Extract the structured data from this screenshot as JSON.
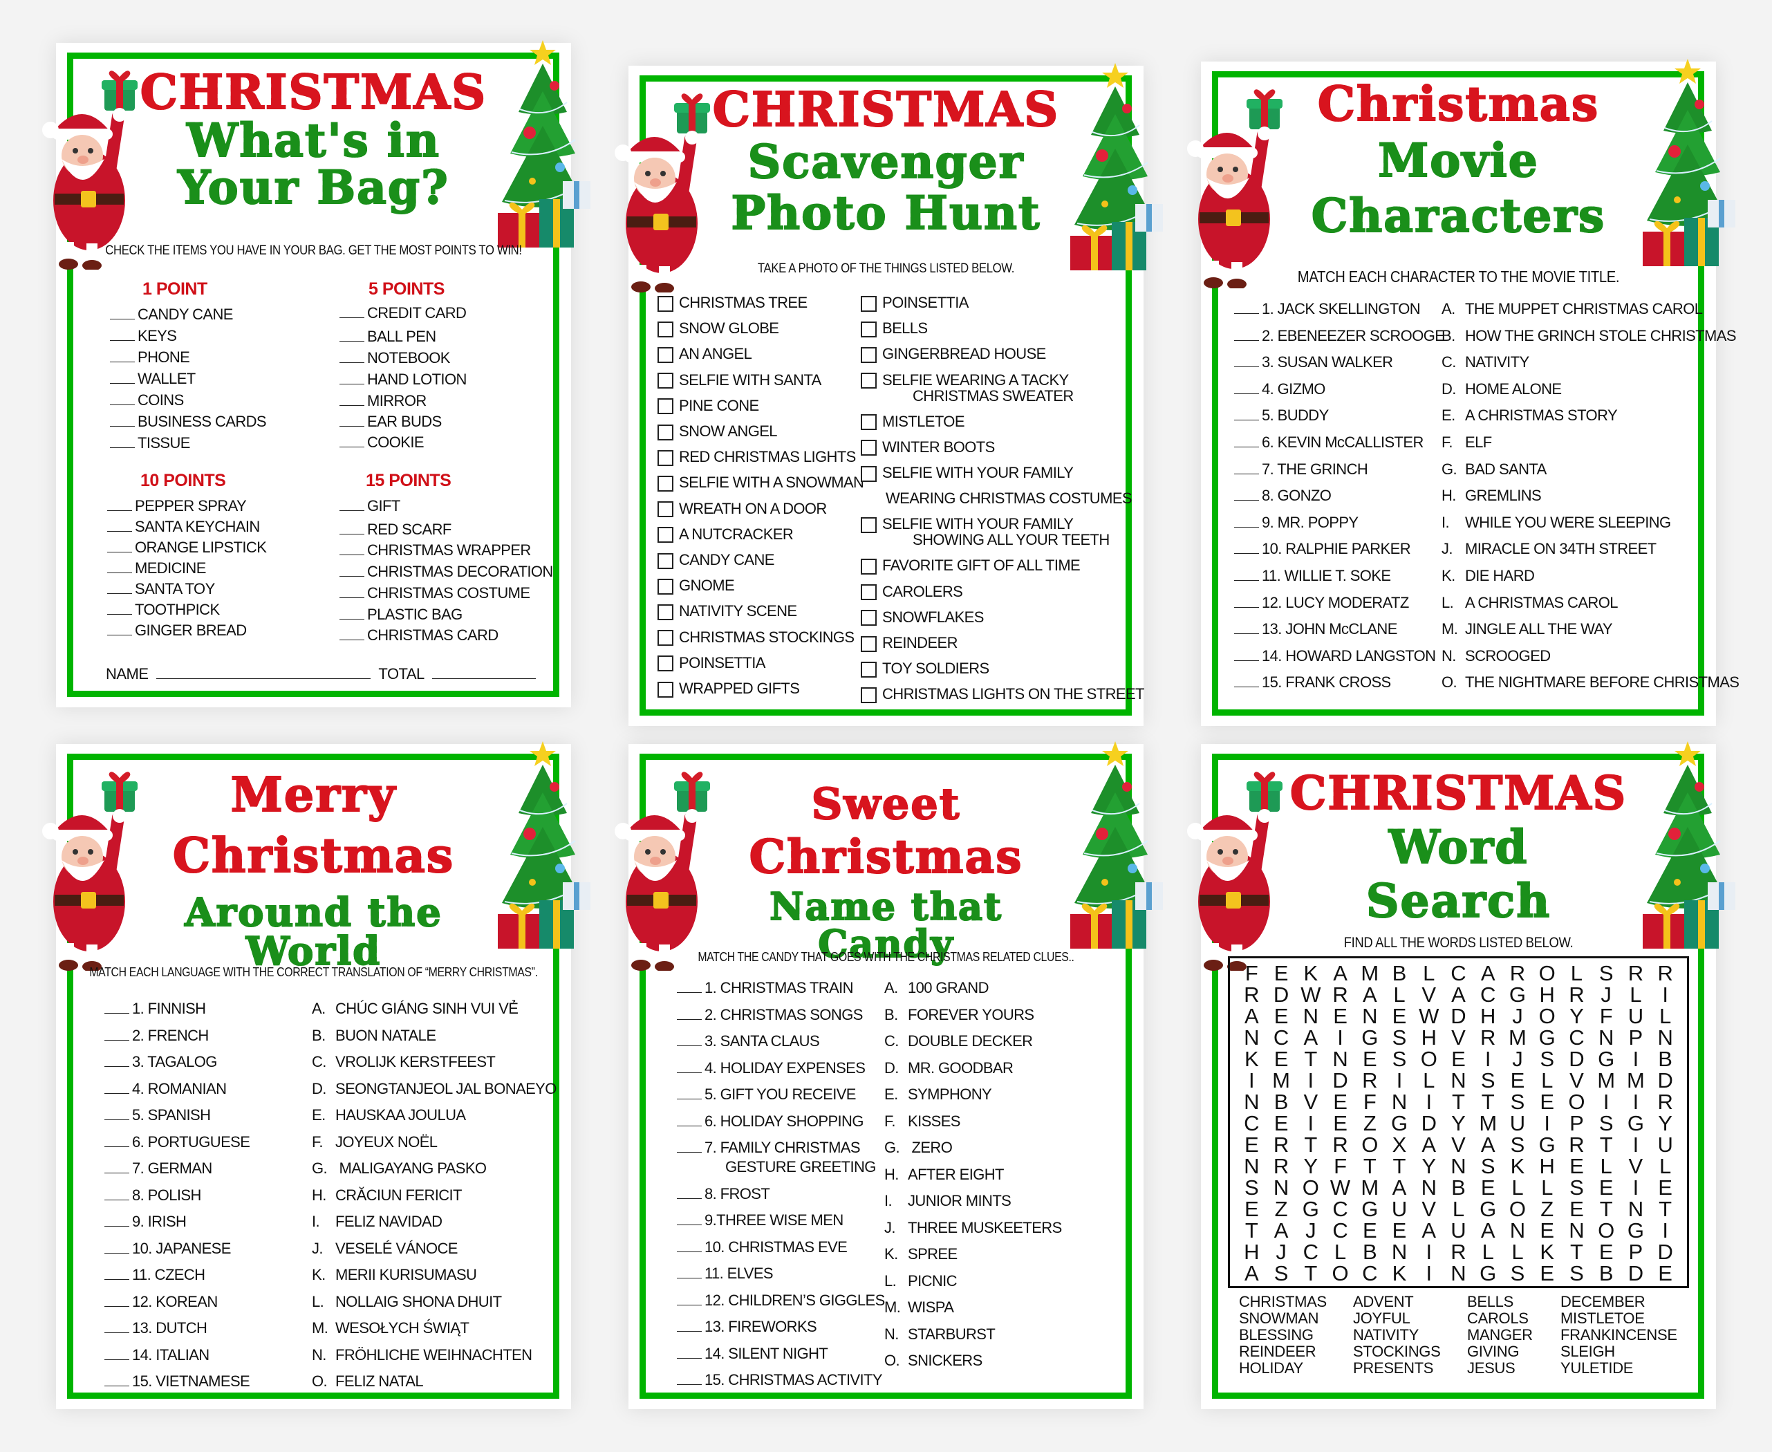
{
  "colors": {
    "border_green": "#00b400",
    "title_red": "#d8141e",
    "title_green": "#1a8f1a",
    "points_red": "#d01018"
  },
  "cards": [
    {
      "id": "whats-in-your-bag",
      "title_lines": [
        "CHRISTMAS",
        "What's in",
        "Your Bag?"
      ],
      "instruction": "CHECK THE ITEMS YOU HAVE IN  YOUR BAG.  GET THE MOST POINTS TO WIN!",
      "groups": [
        {
          "heading": "1 POINT",
          "items": [
            "CANDY CANE",
            "KEYS",
            "PHONE",
            "WALLET",
            "COINS",
            "BUSINESS CARDS",
            "TISSUE"
          ]
        },
        {
          "heading": "5 POINTS",
          "items": [
            "CREDIT CARD",
            "BALL PEN",
            "NOTEBOOK",
            "HAND LOTION",
            "MIRROR",
            "EAR BUDS",
            "COOKIE"
          ]
        },
        {
          "heading": "10 POINTS",
          "items": [
            "PEPPER SPRAY",
            "SANTA KEYCHAIN",
            "ORANGE LIPSTICK",
            "MEDICINE",
            "SANTA TOY",
            "TOOTHPICK",
            "GINGER BREAD"
          ]
        },
        {
          "heading": "15 POINTS",
          "items": [
            "GIFT",
            "RED SCARF",
            "CHRISTMAS WRAPPER",
            "CHRISTMAS DECORATION",
            "CHRISTMAS COSTUME",
            "PLASTIC BAG",
            "CHRISTMAS CARD"
          ]
        }
      ],
      "name_label": "NAME",
      "total_label": "TOTAL"
    },
    {
      "id": "scavenger-photo-hunt",
      "title_lines": [
        "CHRISTMAS",
        "Scavenger",
        "Photo Hunt"
      ],
      "instruction": "TAKE A PHOTO OF THE THINGS LISTED BELOW.",
      "left_items": [
        "CHRISTMAS TREE",
        "SNOW GLOBE",
        "AN ANGEL",
        "SELFIE WITH SANTA",
        "PINE CONE",
        "SNOW ANGEL",
        "RED CHRISTMAS LIGHTS",
        "SELFIE WITH A SNOWMAN",
        "WREATH ON A DOOR",
        "A NUTCRACKER",
        "CANDY CANE",
        "GNOME",
        "NATIVITY SCENE",
        "CHRISTMAS STOCKINGS",
        "POINSETTIA",
        "WRAPPED GIFTS"
      ],
      "right_items": [
        {
          "label": "POINSETTIA",
          "sub": ""
        },
        {
          "label": "BELLS",
          "sub": ""
        },
        {
          "label": "GINGERBREAD HOUSE",
          "sub": ""
        },
        {
          "label": "SELFIE WEARING A TACKY",
          "sub": "CHRISTMAS SWEATER"
        },
        {
          "label": "MISTLETOE",
          "sub": ""
        },
        {
          "label": "WINTER BOOTS",
          "sub": ""
        },
        {
          "label": "SELFIE WITH YOUR FAMILY",
          "sub": ""
        },
        {
          "label": "WEARING CHRISTMAS COSTUMES",
          "sub": "",
          "no_box": true
        },
        {
          "label": "SELFIE WITH YOUR FAMILY",
          "sub": "SHOWING ALL YOUR TEETH"
        },
        {
          "label": "FAVORITE GIFT OF ALL TIME",
          "sub": ""
        },
        {
          "label": "CAROLERS",
          "sub": ""
        },
        {
          "label": "SNOWFLAKES",
          "sub": ""
        },
        {
          "label": "REINDEER",
          "sub": ""
        },
        {
          "label": "TOY SOLDIERS",
          "sub": ""
        },
        {
          "label": "CHRISTMAS LIGHTS ON THE STREET",
          "sub": ""
        }
      ]
    },
    {
      "id": "movie-characters",
      "title_lines": [
        "Christmas",
        "Movie",
        "Characters"
      ],
      "instruction": "MATCH EACH CHARACTER TO THE MOVIE TITLE.",
      "left": [
        "1. JACK SKELLINGTON",
        "2. EBENEEZER SCROOGE",
        "3. SUSAN WALKER",
        "4. GIZMO",
        "5. BUDDY",
        "6. KEVIN McCALLISTER",
        "7. THE GRINCH",
        "8. GONZO",
        "9. MR. POPPY",
        "10. RALPHIE PARKER",
        "11. WILLIE T. SOKE",
        "12. LUCY MODERATZ",
        "13. JOHN McCLANE",
        "14. HOWARD LANGSTON",
        "15. FRANK CROSS"
      ],
      "right": [
        {
          "letter": "A.",
          "text": "THE MUPPET CHRISTMAS CAROL"
        },
        {
          "letter": "B.",
          "text": "HOW THE GRINCH STOLE CHRISTMAS"
        },
        {
          "letter": "C.",
          "text": "NATIVITY"
        },
        {
          "letter": "D.",
          "text": "HOME ALONE"
        },
        {
          "letter": "E.",
          "text": "A CHRISTMAS STORY"
        },
        {
          "letter": "F.",
          "text": "ELF"
        },
        {
          "letter": "G.",
          "text": "BAD SANTA"
        },
        {
          "letter": "H.",
          "text": "GREMLINS"
        },
        {
          "letter": "I.",
          "text": "WHILE YOU WERE SLEEPING"
        },
        {
          "letter": "J.",
          "text": "MIRACLE ON 34TH STREET"
        },
        {
          "letter": "K.",
          "text": "DIE HARD"
        },
        {
          "letter": "L.",
          "text": "A CHRISTMAS CAROL"
        },
        {
          "letter": "M.",
          "text": "JINGLE ALL THE WAY"
        },
        {
          "letter": "N.",
          "text": "SCROOGED"
        },
        {
          "letter": "O.",
          "text": "THE NIGHTMARE BEFORE CHRISTMAS"
        }
      ]
    },
    {
      "id": "around-the-world",
      "title_lines": [
        "Merry",
        "Christmas",
        "Around the World"
      ],
      "instruction": "MATCH EACH LANGUAGE WITH THE CORRECT TRANSLATION OF “MERRY CHRISTMAS”.",
      "left": [
        "1. FINNISH",
        "2. FRENCH",
        "3. TAGALOG",
        "4. ROMANIAN",
        "5. SPANISH",
        "6. PORTUGUESE",
        "7. GERMAN",
        "8. POLISH",
        "9. IRISH",
        "10. JAPANESE",
        "11. CZECH",
        "12. KOREAN",
        "13. DUTCH",
        "14. ITALIAN",
        "15. VIETNAMESE"
      ],
      "right": [
        {
          "letter": "A.",
          "text": "CHÚC GIÁNG SINH VUI VẺ"
        },
        {
          "letter": "B.",
          "text": "BUON NATALE"
        },
        {
          "letter": "C.",
          "text": "VROLIJK KERSTFEEST"
        },
        {
          "letter": "D.",
          "text": "SEONGTANJEOL JAL BONAEYO"
        },
        {
          "letter": "E.",
          "text": "HAUSKAA JOULUA"
        },
        {
          "letter": "F.",
          "text": "JOYEUX NOËL"
        },
        {
          "letter": "G.",
          "text": " MALIGAYANG PASKO"
        },
        {
          "letter": "H.",
          "text": "CRĂCIUN FERICIT"
        },
        {
          "letter": "I.",
          "text": "FELIZ NAVIDAD"
        },
        {
          "letter": "J.",
          "text": "VESELÉ VÁNOCE"
        },
        {
          "letter": "K.",
          "text": "MERII KURISUMASU"
        },
        {
          "letter": "L.",
          "text": "NOLLAIG SHONA DHUIT"
        },
        {
          "letter": "M.",
          "text": "WESOŁYCH ŚWIĄT"
        },
        {
          "letter": "N.",
          "text": "FRÖHLICHE WEIHNACHTEN"
        },
        {
          "letter": "O.",
          "text": "FELIZ NATAL"
        }
      ]
    },
    {
      "id": "name-that-candy",
      "title_lines": [
        "Sweet",
        "Christmas",
        "Name that Candy"
      ],
      "instruction": "MATCH THE CANDY THAT GOES WITH THE CHRISTMAS RELATED CLUES..",
      "left": [
        {
          "text": "1. CHRISTMAS TRAIN",
          "sub": ""
        },
        {
          "text": "2. CHRISTMAS SONGS",
          "sub": ""
        },
        {
          "text": "3. SANTA CLAUS",
          "sub": ""
        },
        {
          "text": "4. HOLIDAY EXPENSES",
          "sub": ""
        },
        {
          "text": "5. GIFT YOU RECEIVE",
          "sub": ""
        },
        {
          "text": "6. HOLIDAY SHOPPING",
          "sub": ""
        },
        {
          "text": "7. FAMILY CHRISTMAS",
          "sub": "GESTURE GREETING"
        },
        {
          "text": "8. FROST",
          "sub": ""
        },
        {
          "text": "9.THREE WISE MEN",
          "sub": ""
        },
        {
          "text": "10. CHRISTMAS EVE",
          "sub": ""
        },
        {
          "text": "11. ELVES",
          "sub": ""
        },
        {
          "text": "12. CHILDREN’S GIGGLES",
          "sub": ""
        },
        {
          "text": "13. FIREWORKS",
          "sub": ""
        },
        {
          "text": "14. SILENT NIGHT",
          "sub": ""
        },
        {
          "text": "15. CHRISTMAS ACTIVITY",
          "sub": ""
        }
      ],
      "right": [
        {
          "letter": "A.",
          "text": "100 GRAND"
        },
        {
          "letter": "B.",
          "text": "FOREVER YOURS"
        },
        {
          "letter": "C.",
          "text": "DOUBLE DECKER"
        },
        {
          "letter": "D.",
          "text": "MR. GOODBAR"
        },
        {
          "letter": "E.",
          "text": "SYMPHONY"
        },
        {
          "letter": "F.",
          "text": "KISSES"
        },
        {
          "letter": "G.",
          "text": " ZERO"
        },
        {
          "letter": "H.",
          "text": "AFTER EIGHT"
        },
        {
          "letter": "I.",
          "text": "JUNIOR MINTS"
        },
        {
          "letter": "J.",
          "text": "THREE MUSKEETERS"
        },
        {
          "letter": "K.",
          "text": "SPREE"
        },
        {
          "letter": "L.",
          "text": "PICNIC"
        },
        {
          "letter": "M.",
          "text": "WISPA"
        },
        {
          "letter": "N.",
          "text": "STARBURST"
        },
        {
          "letter": "O.",
          "text": "SNICKERS"
        }
      ]
    },
    {
      "id": "word-search",
      "title_lines": [
        "CHRISTMAS",
        "Word",
        "Search"
      ],
      "instruction": "FIND ALL THE WORDS LISTED BELOW.",
      "grid": [
        "FEKAMBLCAROLSRR",
        "RDWRALVACGHRJLI",
        "AENENEWDHJOYFUL",
        "NCAIGSHVRMGCNPN",
        "KETNESOEIJSDGIB",
        "IMIDRILNSELVMMD",
        "NBVEFNITTSEOIIR",
        "CEIEZGDYMUIPSGY",
        "ERTROXAVASGRTIU",
        "NRYFTTYNSKHELVL",
        "SNOWMANBELLSEIE",
        "EZGCGUVLGOZETNT",
        "TAJCEEAUANENOGI",
        "HJCLBNIRLLKTEPD",
        "ASTOCKINGSESBDE"
      ],
      "words": [
        [
          "CHRISTMAS",
          "ADVENT",
          "BELLS",
          "DECEMBER"
        ],
        [
          "SNOWMAN",
          "JOYFUL",
          "CAROLS",
          "MISTLETOE"
        ],
        [
          "BLESSING",
          "NATIVITY",
          "MANGER",
          "FRANKINCENSE"
        ],
        [
          "REINDEER",
          "STOCKINGS",
          "GIVING",
          "SLEIGH"
        ],
        [
          "HOLIDAY",
          "PRESENTS",
          "JESUS",
          "YULETIDE"
        ]
      ]
    }
  ]
}
